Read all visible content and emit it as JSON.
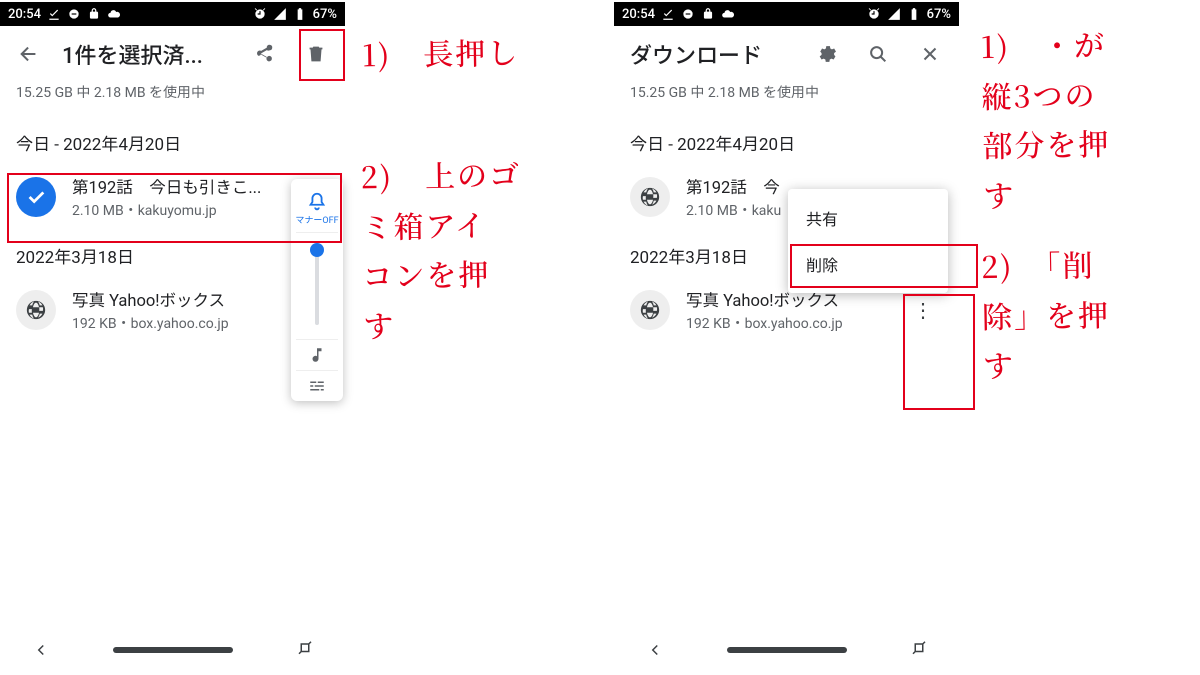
{
  "statusbar": {
    "time": "20:54",
    "battery": "67%"
  },
  "left": {
    "appbar_title": "1件を選択済...",
    "storage": "15.25 GB 中 2.18 MB を使用中",
    "date1": "今日 - 2022年4月20日",
    "item1_title": "第192話　今日も引きこ...",
    "item1_sub": "2.10 MB・kakuyomu.jp",
    "date2": "2022年3月18日",
    "item2_title": "写真 Yahoo!ボックス",
    "item2_sub": "192 KB・box.yahoo.co.jp",
    "volume_label": "マナーOFF"
  },
  "right": {
    "appbar_title": "ダウンロード",
    "storage": "15.25 GB 中 2.18 MB を使用中",
    "date1": "今日 - 2022年4月20日",
    "item1_title": "第192話　今",
    "item1_sub": "2.10 MB・kaku",
    "date2": "2022年3月18日",
    "item2_title": "写真 Yahoo!ボックス",
    "item2_sub": "192 KB・box.yahoo.co.jp",
    "menu_share": "共有",
    "menu_delete": "削除"
  },
  "annotations": {
    "left1": "1)　長押し",
    "left2": "2)　上のゴ\nミ箱アイ\nコンを押\nす",
    "right1": "1)　・が\n縦3つの\n部分を押\nす",
    "right2": "2)　「削\n除」を押\nす"
  }
}
